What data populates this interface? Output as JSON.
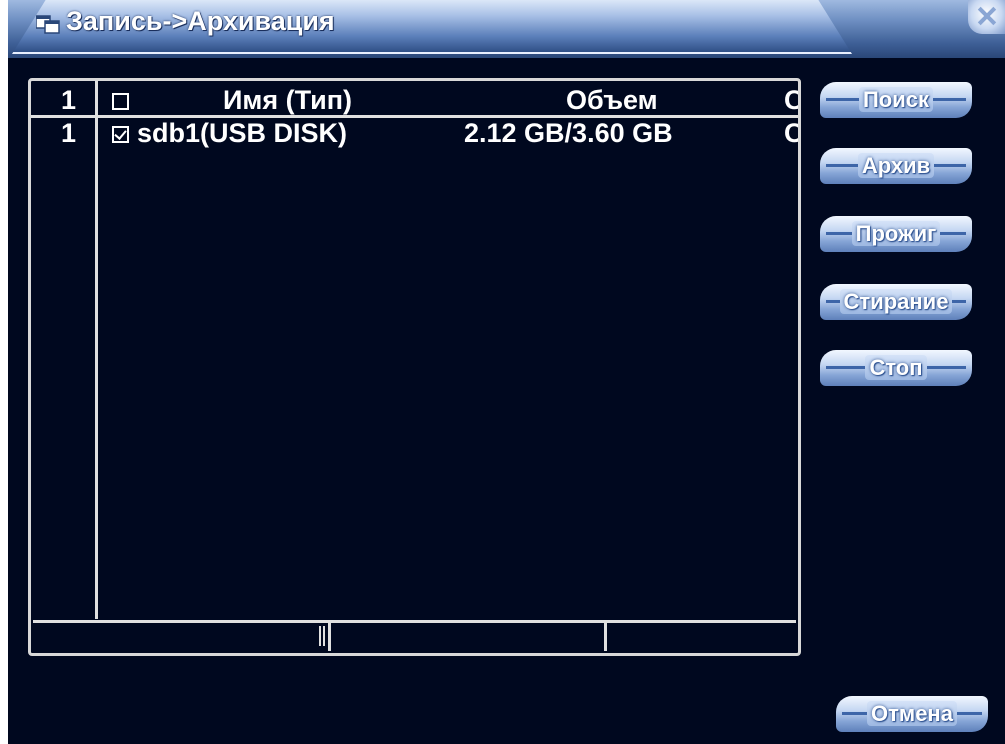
{
  "window": {
    "title": "Запись->Архивация",
    "close_label": ""
  },
  "table": {
    "headers": {
      "index": "1",
      "name": "Имя (Тип)",
      "size": "Объем",
      "extra": "С"
    },
    "rows": [
      {
        "index": "1",
        "checked": true,
        "name": "sdb1(USB DISK)",
        "size": "2.12 GB/3.60 GB",
        "extra": "С"
      }
    ]
  },
  "buttons": {
    "search": "Поиск",
    "archive": "Архив",
    "burn": "Прожиг",
    "erase": "Стирание",
    "stop": "Стоп",
    "cancel": "Отмена"
  },
  "colors": {
    "background": "#00081f",
    "titlebar": "#6e8fc2",
    "button": "#a8c0e6",
    "text": "#ffffff"
  },
  "icons": {
    "title": "windows-icon",
    "close": "close-icon"
  }
}
